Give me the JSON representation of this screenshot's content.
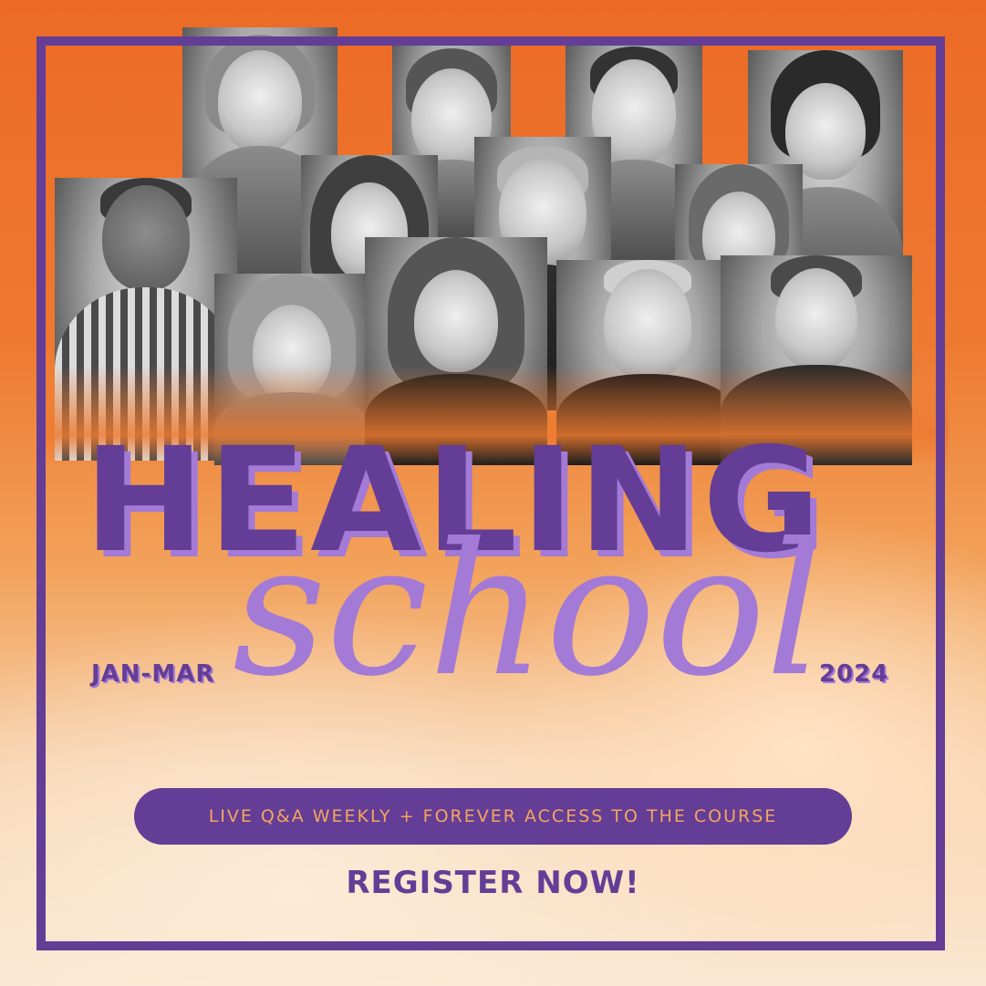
{
  "poster": {
    "title_main": "HEALING",
    "title_script": "school",
    "date_range": "JAN-MAR",
    "year": "2024",
    "banner": "LIVE Q&A WEEKLY + FOREVER ACCESS TO THE COURSE",
    "cta": "REGISTER NOW!"
  },
  "colors": {
    "primary_purple": "#643d96",
    "light_purple": "#a37ad6",
    "orange": "#ec6a26",
    "banner_text": "#f4a65e"
  },
  "photo_group": {
    "people_count": 12,
    "style": "black-and-white"
  }
}
